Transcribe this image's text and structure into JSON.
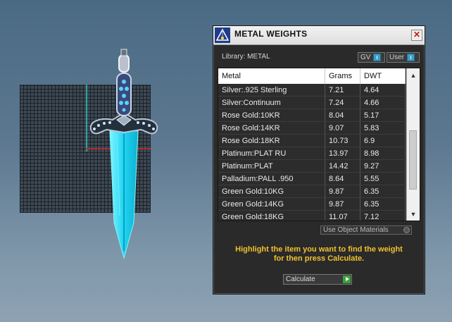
{
  "dialog": {
    "title": "METAL WEIGHTS",
    "close_symbol": "✕",
    "library_label": "Library: METAL",
    "toggles": [
      {
        "label": "GV",
        "state": "on"
      },
      {
        "label": "User",
        "state": "on"
      }
    ],
    "table": {
      "headers": [
        "Metal",
        "Grams",
        "DWT"
      ],
      "rows": [
        [
          "Silver:.925 Sterling",
          "7.21",
          "4.64"
        ],
        [
          "Silver:Continuum",
          "7.24",
          "4.66"
        ],
        [
          "Rose Gold:10KR",
          "8.04",
          "5.17"
        ],
        [
          "Rose Gold:14KR",
          "9.07",
          "5.83"
        ],
        [
          "Rose Gold:18KR",
          "10.73",
          "6.9"
        ],
        [
          "Platinum:PLAT RU",
          "13.97",
          "8.98"
        ],
        [
          "Platinum:PLAT",
          "14.42",
          "9.27"
        ],
        [
          "Palladium:PALL .950",
          "8.64",
          "5.55"
        ],
        [
          "Green Gold:10KG",
          "9.87",
          "6.35"
        ],
        [
          "Green Gold:14KG",
          "9.87",
          "6.35"
        ],
        [
          "Green Gold:18KG",
          "11.07",
          "7.12"
        ]
      ]
    },
    "use_object_materials_label": "Use Object Materials",
    "hint_line1": "Highlight the item you want to find the weight",
    "hint_line2": "for then press Calculate.",
    "calculate_label": "Calculate"
  },
  "colors": {
    "hint": "#f2c12e",
    "toggle_on": "#3aa0c8",
    "go_button": "#3aa33a",
    "blade": "#35e0ff"
  }
}
